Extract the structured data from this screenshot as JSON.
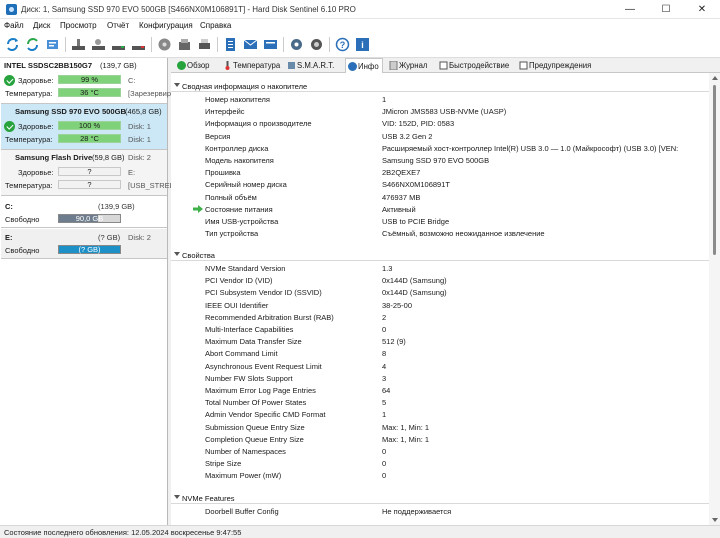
{
  "window": {
    "title": "Диск: 1, Samsung SSD 970 EVO 500GB [S466NX0M106891T]  -  Hard Disk Sentinel 6.10 PRO",
    "minimize": "—",
    "maximize": "☐",
    "close": "✕"
  },
  "menu": [
    "Файл",
    "Диск",
    "Просмотр",
    "Отчёт",
    "Конфигурация",
    "Справка"
  ],
  "toolbar_icons": [
    "refresh-icon",
    "refresh-all-icon",
    "report-icon",
    "disk-test-icon",
    "surface-test-icon",
    "smart-test-icon",
    "hdd-icon",
    "drive-scan-icon",
    "save-icon",
    "print-icon",
    "document-icon",
    "email-icon",
    "message-icon",
    "settings-icon",
    "sound-icon",
    "help-icon",
    "info-icon"
  ],
  "disks": [
    {
      "name": "INTEL SSDSC2BB150G7",
      "size": "(139,7 GB)",
      "health_label": "Здоровье:",
      "health": "99 %",
      "health_extra": "C:",
      "temp_label": "Температура:",
      "temp": "36 °C",
      "temp_extra": "[Зарезервир",
      "status": "ok"
    },
    {
      "name": "Samsung SSD 970 EVO 500GB",
      "size": "(465,8 GB)",
      "health_label": "Здоровье:",
      "health": "100 %",
      "health_extra": "Disk: 1",
      "temp_label": "Температура:",
      "temp": "28 °C",
      "temp_extra": "Disk: 1",
      "status": "ok"
    },
    {
      "name": "Samsung Flash Drive",
      "size": "(59,8 GB)",
      "health_label": "Здоровье:",
      "health": "?",
      "health_extra": "E:",
      "temp_label": "Температура:",
      "temp": "?",
      "temp_extra": "[USB_STREL",
      "status": "unknown",
      "disk_no": "Disk: 2"
    }
  ],
  "volumes": [
    {
      "letter": "C:",
      "size": "(139,9 GB)",
      "free_label": "Свободно",
      "free": "90,0 GB",
      "free_fraction": 0.64
    },
    {
      "letter": "E:",
      "size": "(? GB)",
      "free_label": "Свободно",
      "free": "(? GB)",
      "free_fraction": 1.0,
      "disk_no": "Disk: 2"
    }
  ],
  "tabs": [
    "Обзор",
    "Температура",
    "S.M.A.R.T.",
    "Инфо",
    "Журнал",
    "Быстродействие",
    "Предупреждения"
  ],
  "active_tab": "Инфо",
  "sections": {
    "summary": {
      "title": "Сводная информация о накопителе",
      "rows": [
        [
          "Номер накопителя",
          "1"
        ],
        [
          "Интерфейс",
          "JMicron JMS583 USB-NVMe (UASP)"
        ],
        [
          "Информация о производителе",
          "VID: 152D, PID: 0583"
        ],
        [
          "Версия",
          "USB 3.2 Gen 2"
        ],
        [
          "Контроллер диска",
          "Расширяемый хост-контроллер Intel(R) USB 3.0 — 1.0 (Майкрософт) (USB 3.0) [VEN:"
        ],
        [
          "Модель накопителя",
          "Samsung SSD 970 EVO 500GB"
        ],
        [
          "Прошивка",
          "2B2QEXE7"
        ],
        [
          "Серийный номер диска",
          "S466NX0M106891T"
        ],
        [
          "Полный объём",
          "476937 MB"
        ],
        [
          "Состояние питания",
          "Активный"
        ],
        [
          "Имя USB-устройства",
          "USB to PCIE Bridge"
        ],
        [
          "Тип устройства",
          "Съёмный, возможно неожиданное извлечение"
        ]
      ],
      "highlight_row": 9
    },
    "props": {
      "title": "Свойства",
      "rows": [
        [
          "NVMe Standard Version",
          "1.3"
        ],
        [
          "PCI Vendor ID (VID)",
          "0x144D (Samsung)"
        ],
        [
          "PCI Subsystem Vendor ID (SSVID)",
          "0x144D (Samsung)"
        ],
        [
          "IEEE OUI Identifier",
          "38-25-00"
        ],
        [
          "Recommended Arbitration Burst (RAB)",
          "2"
        ],
        [
          "Multi-Interface Capabilities",
          "0"
        ],
        [
          "Maximum Data Transfer Size",
          "512 (9)"
        ],
        [
          "Abort Command Limit",
          "8"
        ],
        [
          "Asynchronous Event Request Limit",
          "4"
        ],
        [
          "Number FW Slots Support",
          "3"
        ],
        [
          "Maximum Error Log Page Entries",
          "64"
        ],
        [
          "Total Number Of Power States",
          "5"
        ],
        [
          "Admin Vendor Specific CMD Format",
          "1"
        ],
        [
          "Submission Queue Entry Size",
          "Max: 1, Min: 1"
        ],
        [
          "Completion Queue Entry Size",
          "Max: 1, Min: 1"
        ],
        [
          "Number of Namespaces",
          "0"
        ],
        [
          "Stripe Size",
          "0"
        ],
        [
          "Maximum Power (mW)",
          "0"
        ]
      ]
    },
    "features": {
      "title": "NVMe Features",
      "rows": [
        [
          "Doorbell Buffer Config",
          "Не поддерживается"
        ]
      ]
    }
  },
  "status_bar": "Состояние последнего обновления: 12.05.2024 воскресенье 9:47:55",
  "colors": {
    "health_green": "#7fd27a",
    "selected": "#cce8f7",
    "ok": "#27a33d",
    "volume_blue": "#1e90c8"
  }
}
